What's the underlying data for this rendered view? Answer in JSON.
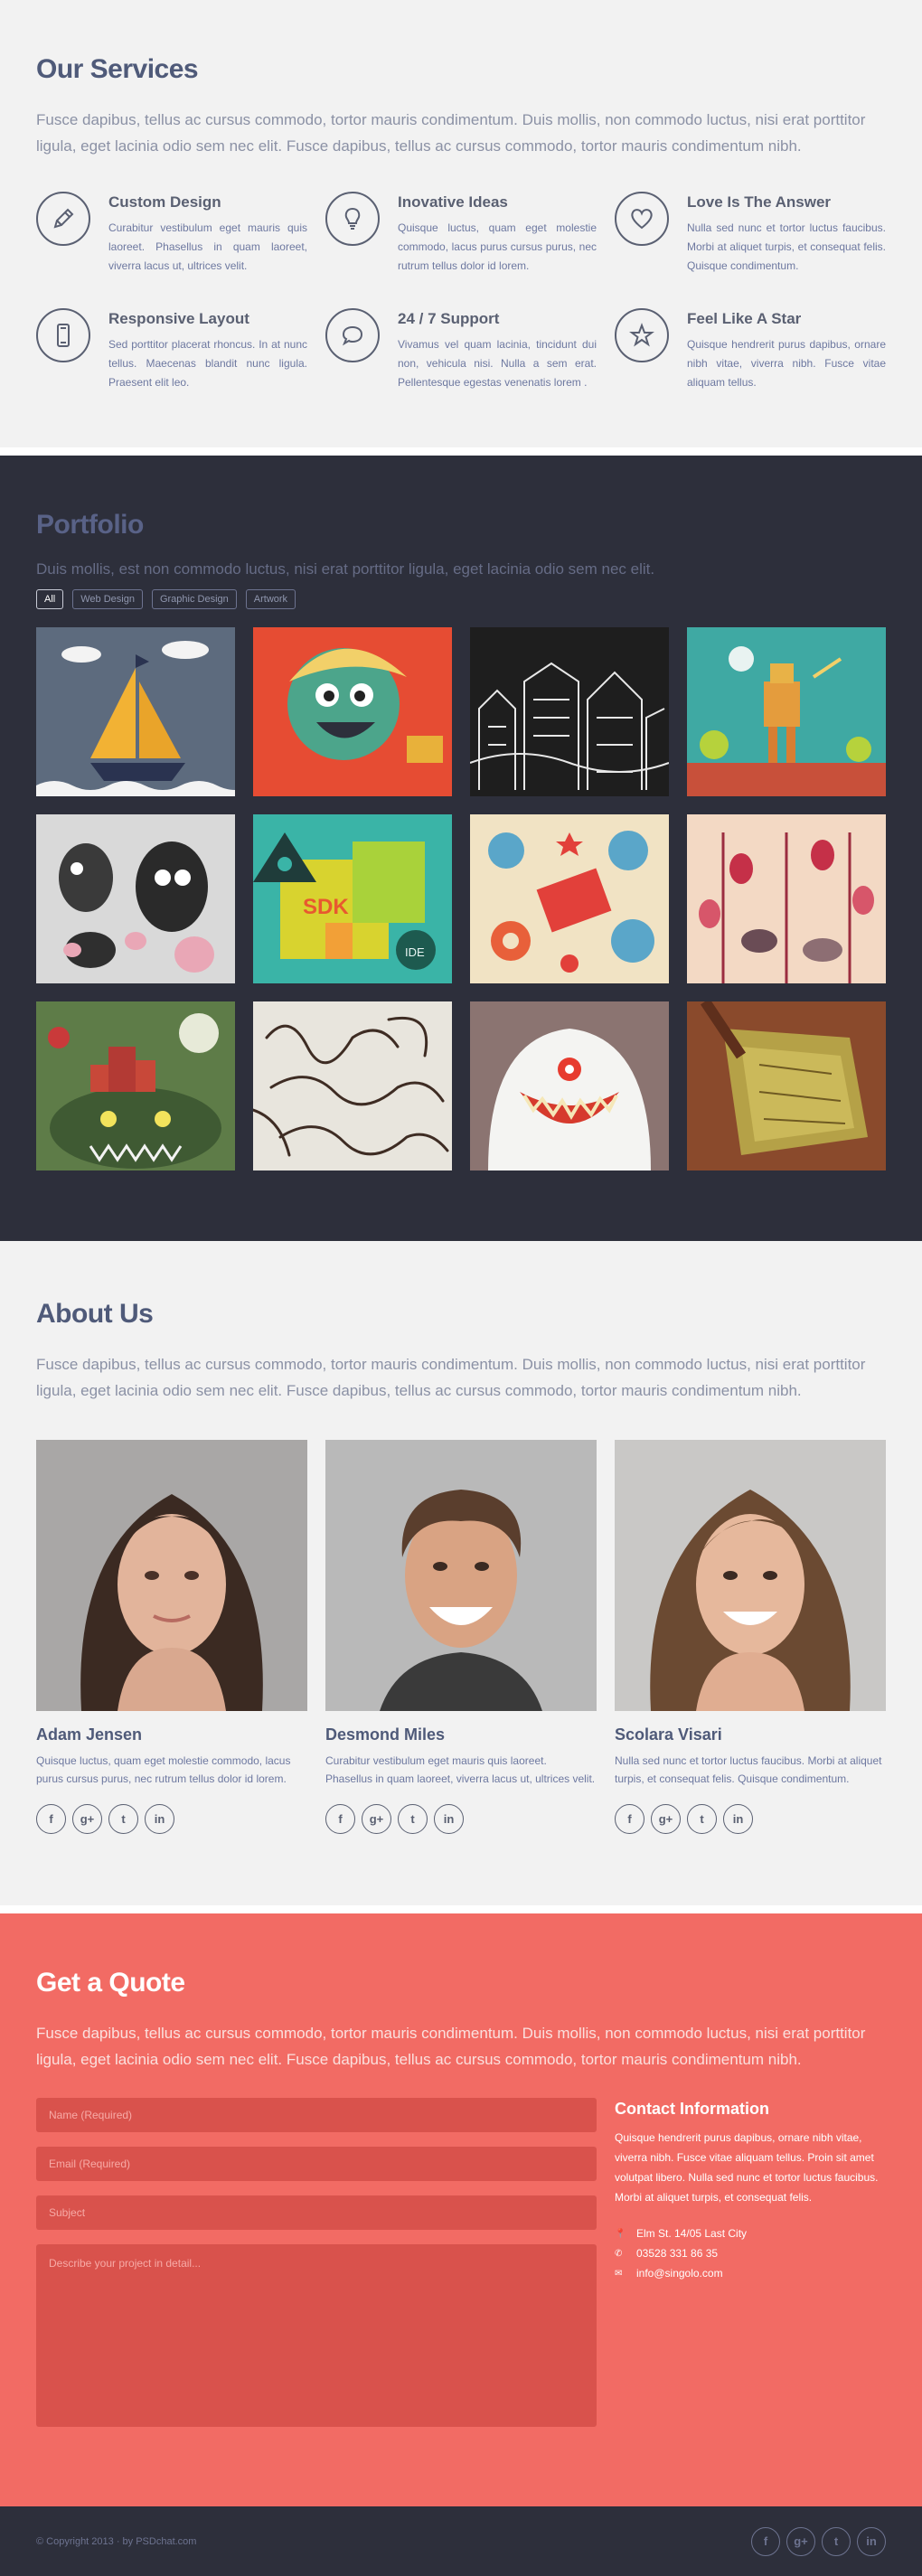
{
  "services": {
    "title": "Our Services",
    "intro": "Fusce dapibus, tellus ac cursus commodo, tortor mauris condimentum. Duis mollis, non commodo luctus, nisi erat porttitor ligula, eget lacinia odio sem nec elit. Fusce dapibus, tellus ac cursus commodo, tortor mauris condimentum nibh.",
    "items": [
      {
        "icon": "pencil-icon",
        "title": "Custom Design",
        "text": "Curabitur vestibulum eget mauris quis laoreet. Phasellus in quam laoreet, viverra lacus ut, ultrices velit."
      },
      {
        "icon": "lightbulb-icon",
        "title": "Inovative Ideas",
        "text": "Quisque luctus, quam eget molestie commodo, lacus purus cursus purus, nec rutrum tellus dolor id lorem."
      },
      {
        "icon": "heart-icon",
        "title": "Love Is The Answer",
        "text": "Nulla sed nunc et tortor luctus faucibus. Morbi at aliquet turpis, et consequat felis. Quisque condimentum."
      },
      {
        "icon": "mobile-icon",
        "title": "Responsive Layout",
        "text": "Sed porttitor placerat rhoncus. In at nunc tellus. Maecenas blandit nunc ligula. Praesent elit leo."
      },
      {
        "icon": "chat-bubble-icon",
        "title": "24 / 7 Support",
        "text": "Vivamus vel quam lacinia, tincidunt dui non, vehicula nisi. Nulla a sem erat. Pellentesque egestas venenatis lorem ."
      },
      {
        "icon": "star-icon",
        "title": "Feel Like A Star",
        "text": "Quisque hendrerit purus dapibus, ornare nibh vitae, viverra nibh. Fusce vitae aliquam tellus."
      }
    ]
  },
  "portfolio": {
    "title": "Portfolio",
    "subtitle": "Duis mollis, est non commodo luctus, nisi erat porttitor ligula, eget lacinia odio sem nec elit.",
    "filters": [
      "All",
      "Web Design",
      "Graphic Design",
      "Artwork"
    ],
    "active_filter": "All",
    "tiles": [
      "sailboat-illustration",
      "green-monster-illustration",
      "doodle-city-illustration",
      "robot-in-desert-illustration",
      "monster-doodles-illustration",
      "sdk-abstract-illustration",
      "robots-pattern-illustration",
      "birds-eggs-pattern-illustration",
      "green-castle-monster-illustration",
      "hand-lettering-illustration",
      "white-yeti-illustration",
      "brown-abstract-illustration"
    ]
  },
  "about": {
    "title": "About Us",
    "intro": "Fusce dapibus, tellus ac cursus commodo, tortor mauris condimentum. Duis mollis, non commodo luctus, nisi erat porttitor ligula, eget lacinia odio sem nec elit. Fusce dapibus, tellus ac cursus commodo, tortor mauris condimentum nibh.",
    "members": [
      {
        "name": "Adam Jensen",
        "text": "Quisque luctus, quam eget molestie commodo, lacus purus cursus purus, nec rutrum tellus dolor id lorem."
      },
      {
        "name": "Desmond Miles",
        "text": "Curabitur vestibulum eget mauris quis laoreet. Phasellus in quam laoreet, viverra lacus ut, ultrices velit."
      },
      {
        "name": "Scolara Visari",
        "text": "Nulla sed nunc et tortor luctus faucibus. Morbi at aliquet turpis, et consequat felis. Quisque condimentum."
      }
    ],
    "social_icons": [
      "facebook-icon",
      "google-plus-icon",
      "twitter-icon",
      "linkedin-icon"
    ]
  },
  "quote": {
    "title": "Get a Quote",
    "intro": "Fusce dapibus, tellus ac cursus commodo, tortor mauris condimentum. Duis mollis, non commodo luctus, nisi erat porttitor ligula, eget lacinia odio sem nec elit. Fusce dapibus, tellus ac cursus commodo, tortor mauris condimentum nibh.",
    "form": {
      "name_placeholder": "Name (Required)",
      "email_placeholder": "Email (Required)",
      "subject_placeholder": "Subject",
      "message_placeholder": "Describe your project in detail..."
    },
    "contact": {
      "title": "Contact Information",
      "text": "Quisque hendrerit purus dapibus, ornare nibh vitae, viverra nibh. Fusce vitae aliquam tellus. Proin sit amet volutpat libero. Nulla sed nunc et tortor luctus faucibus. Morbi at aliquet turpis, et consequat felis.",
      "address": "Elm St. 14/05 Last City",
      "phone": "03528 331 86 35",
      "email": "info@singolo.com"
    }
  },
  "footer": {
    "copyright": "© Copyright 2013 · by PSDchat.com"
  },
  "colors": {
    "heading": "#4f5a79",
    "dark_bg": "#2d2f3b",
    "quote_bg": "#f26b64",
    "field_bg": "#d9524c"
  }
}
